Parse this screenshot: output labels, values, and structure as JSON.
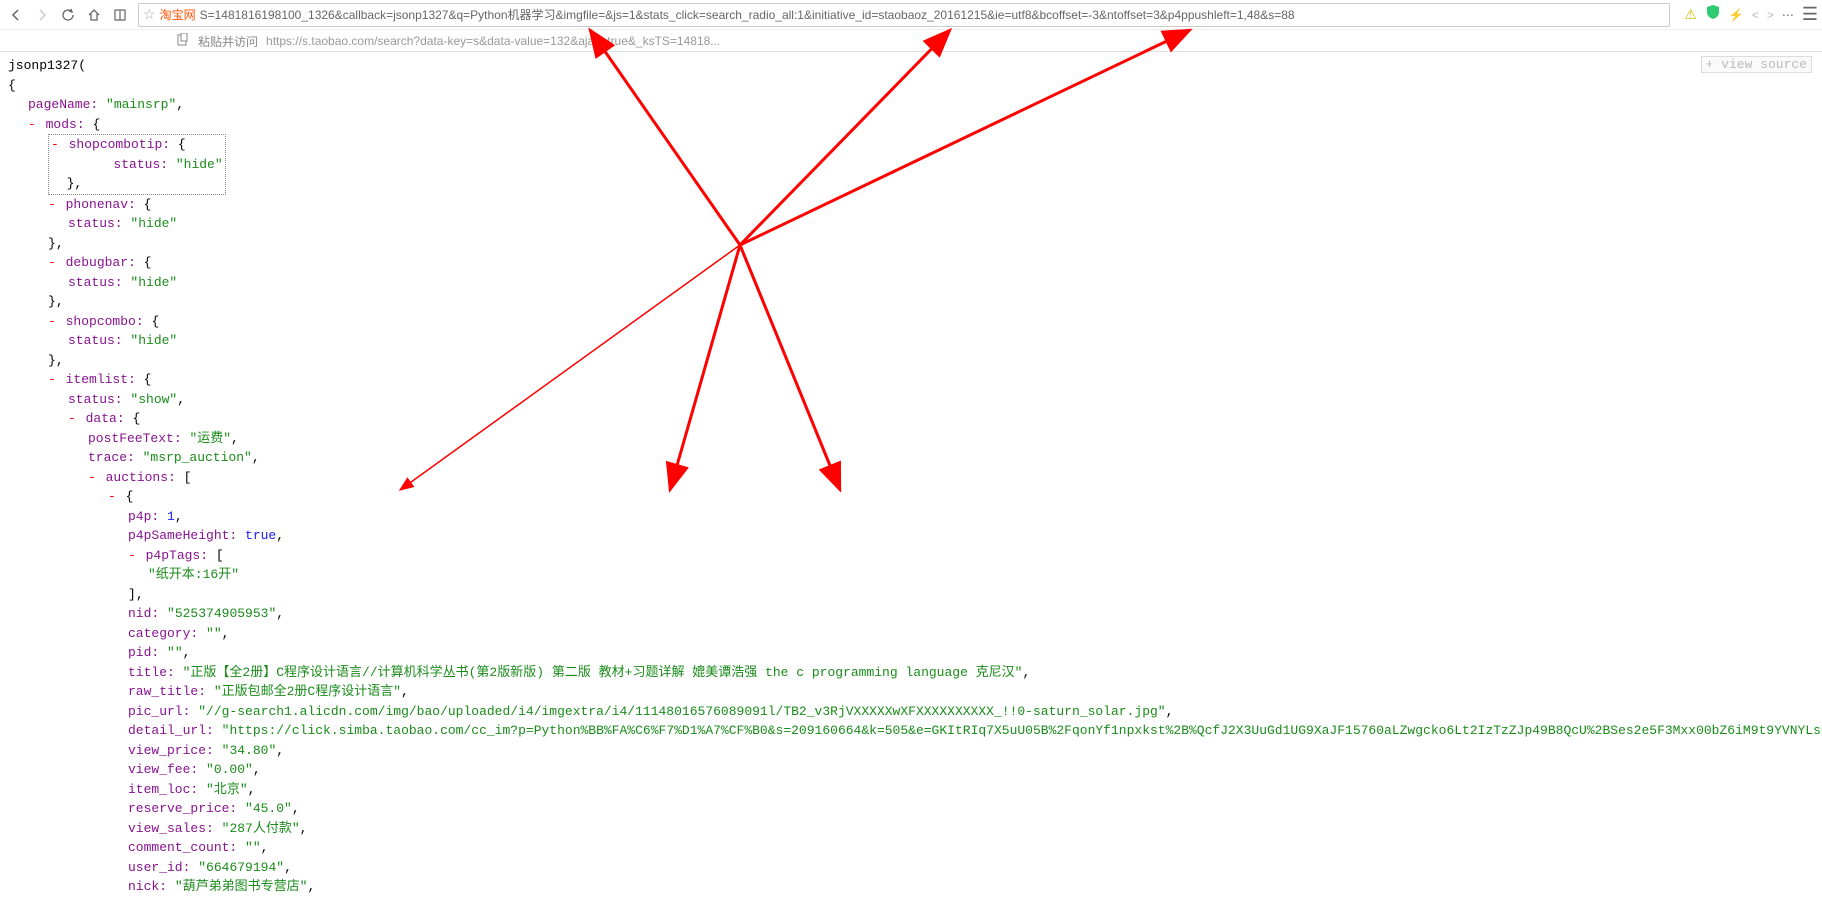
{
  "browser": {
    "site_name": "淘宝网",
    "url": "S=1481816198100_1326&callback=jsonp1327&q=Python机器学习&imgfile=&js=1&stats_click=search_radio_all:1&initiative_id=staobaoz_20161215&ie=utf8&bcoffset=-3&ntoffset=3&p4ppushleft=1,48&s=88",
    "sub_label": "粘贴并访问",
    "sub_url": "https://s.taobao.com/search?data-key=s&data-value=132&ajax=true&_ksTS=14818...",
    "view_source": "+ view source"
  },
  "json": {
    "callback_name": "jsonp1327(",
    "pageName_key": "pageName:",
    "pageName_val": "\"mainsrp\"",
    "mods_key": "mods:",
    "shopcombotip_key": "shopcombotip:",
    "phonenav_key": "phonenav:",
    "debugbar_key": "debugbar:",
    "shopcombo_key": "shopcombo:",
    "status_key": "status:",
    "status_hide": "\"hide\"",
    "status_show": "\"show\"",
    "itemlist_key": "itemlist:",
    "data_key": "data:",
    "postFeeText_key": "postFeeText:",
    "postFeeText_val": "\"运费\"",
    "trace_key": "trace:",
    "trace_val": "\"msrp_auction\"",
    "auctions_key": "auctions:",
    "p4p_key": "p4p:",
    "p4p_val": "1",
    "p4pSameHeight_key": "p4pSameHeight:",
    "p4pSameHeight_val": "true",
    "p4pTags_key": "p4pTags:",
    "p4pTags_val": "\"纸开本:16开\"",
    "nid_key": "nid:",
    "nid_val": "\"525374905953\"",
    "category_key": "category:",
    "category_val": "\"\"",
    "pid_key": "pid:",
    "pid_val": "\"\"",
    "title_key": "title:",
    "title_val": "\"正版【全2册】C程序设计语言//计算机科学丛书(第2版新版) 第二版 教材+习题详解 媲美谭浩强 the c programming language 克尼汉\"",
    "raw_title_key": "raw_title:",
    "raw_title_val": "\"正版包邮全2册C程序设计语言\"",
    "pic_url_key": "pic_url:",
    "pic_url_val": "\"//g-search1.alicdn.com/img/bao/uploaded/i4/imgextra/i4/11148016576089091l/TB2_v3RjVXXXXXwXFXXXXXXXXXX_!!0-saturn_solar.jpg\"",
    "detail_url_key": "detail_url:",
    "detail_url_val": "\"https://click.simba.taobao.com/cc_im?p=Python%BB%FA%C6%F7%D1%A7%CF%B0&s=209160664&k=505&e=GKItRIq7X5uU05B%2FqonYf1npxkst%2B%QcfJ2X3UuGd1UG9XaJF15760aLZwgcko6Lt2IzTzZJp49B8QcU%2BSes2e5F3Mxx00bZ6iM9t9YVNYLsDKh1hBwiNCNpJaJTI0D1AX7ZRwHuyKhgYeR",
    "view_price_key": "view_price:",
    "view_price_val": "\"34.80\"",
    "view_fee_key": "view_fee:",
    "view_fee_val": "\"0.00\"",
    "item_loc_key": "item_loc:",
    "item_loc_val": "\"北京\"",
    "reserve_price_key": "reserve_price:",
    "reserve_price_val": "\"45.0\"",
    "view_sales_key": "view_sales:",
    "view_sales_val": "\"287人付款\"",
    "comment_count_key": "comment_count:",
    "comment_count_val": "\"\"",
    "user_id_key": "user_id:",
    "user_id_val": "\"664679194\"",
    "nick_key": "nick:",
    "nick_val": "\"葫芦弟弟图书专营店\"",
    "brace_open": "{",
    "brace_close": "}",
    "bracket_open": "[",
    "bracket_close": "]",
    "comma": ",",
    "minus": "-"
  }
}
